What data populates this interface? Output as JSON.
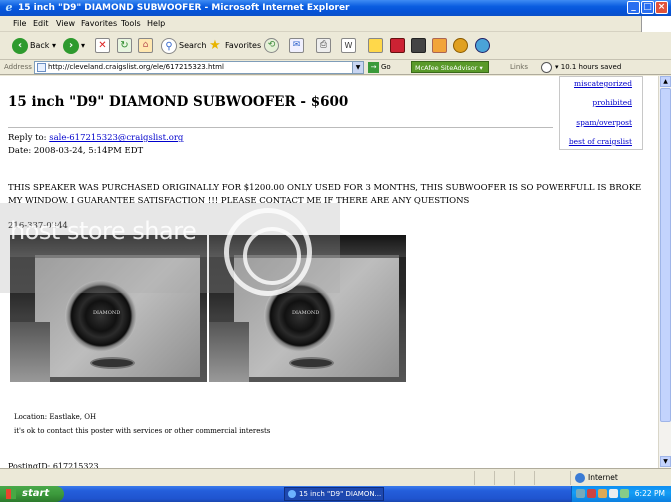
{
  "window": {
    "title": "15 inch \"D9\" DIAMOND SUBWOOFER - Microsoft Internet Explorer",
    "controls": [
      "_",
      "□",
      "×"
    ]
  },
  "menubar": {
    "items": [
      "File",
      "Edit",
      "View",
      "Favorites",
      "Tools",
      "Help"
    ]
  },
  "toolbar": {
    "back_label": "Back",
    "search_label": "Search",
    "favorites_label": "Favorites"
  },
  "addressbar": {
    "label": "Address",
    "url": "http://cleveland.craigslist.org/ele/617215323.html",
    "go_label": "Go",
    "mcafee_label": "McAfee SiteAdvisor ▾",
    "links_label": "Links",
    "saved_label": "10.1 hours saved"
  },
  "sidebar": {
    "links": [
      "miscategorized",
      "prohibited",
      "spam/overpost",
      "best of craigslist"
    ]
  },
  "post": {
    "title": "15 inch \"D9\" DIAMOND SUBWOOFER - $600",
    "reply_prefix": "Reply to:",
    "reply_email": "sale-617215323@craigslist.org",
    "date": "Date: 2008-03-24, 5:14PM EDT",
    "body": "THIS SPEAKER WAS PURCHASED ORIGINALLY FOR $1200.00 ONLY USED FOR 3 MONTHS, THIS SUBWOOFER IS SO POWERFULL IS BROKE MY WINDOW. I GUARANTEE SATISFACTION !!! PLEASE CONTACT ME IF THERE ARE ANY QUESTIONS",
    "phone": "216-337-0344",
    "location": "Location: Eastlake, OH",
    "contact_note": "it's ok to contact this poster with services or other commercial interests",
    "posting_id": "PostingID: 617215323",
    "speaker_brand": "DIAMOND"
  },
  "watermark": {
    "text": "host store share"
  },
  "statusbar": {
    "zone": "Internet"
  },
  "taskbar": {
    "start_label": "start",
    "task_label": "15 inch \"D9\" DIAMON...",
    "clock": "6:22 PM"
  }
}
